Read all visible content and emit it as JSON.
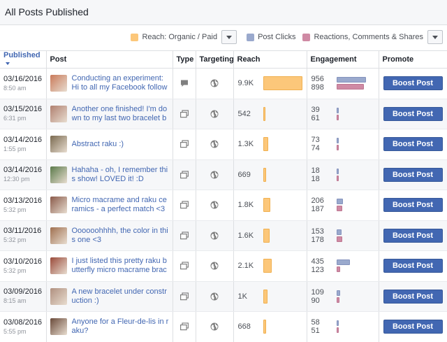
{
  "page_title": "All Posts Published",
  "legend": [
    {
      "label": "Reach: Organic / Paid",
      "color": "#fcc77a"
    },
    {
      "label": "Post Clicks",
      "color": "#9aa9cd"
    },
    {
      "label": "Reactions, Comments & Shares",
      "color": "#cf8aa4"
    }
  ],
  "columns": {
    "published": "Published",
    "post": "Post",
    "type": "Type",
    "targeting": "Targeting",
    "reach": "Reach",
    "engagement": "Engagement",
    "promote": "Promote"
  },
  "max_reach": 9900,
  "max_engagement": 956,
  "posts": [
    {
      "date": "03/16/2016",
      "time": "8:50 am",
      "text": "Conducting an experiment: Hi to all my Facebook followers! Did y",
      "type_icon": "chat-bubble-icon",
      "reach_label": "9.9K",
      "reach": 9900,
      "clicks": 956,
      "reactions": 898,
      "boost_label": "Boost Post",
      "thumb_color": "#c97a5a"
    },
    {
      "date": "03/15/2016",
      "time": "6:31 pm",
      "text": "Another one finished! I'm down to my last two bracelet bars :(",
      "type_icon": "photo-stack-icon",
      "reach_label": "542",
      "reach": 542,
      "clicks": 39,
      "reactions": 61,
      "boost_label": "Boost Post",
      "thumb_color": "#b08070"
    },
    {
      "date": "03/14/2016",
      "time": "1:55 pm",
      "text": "Abstract raku :)",
      "type_icon": "photo-stack-icon",
      "reach_label": "1.3K",
      "reach": 1300,
      "clicks": 73,
      "reactions": 74,
      "boost_label": "Boost Post",
      "thumb_color": "#7a6a50"
    },
    {
      "date": "03/14/2016",
      "time": "12:30 pm",
      "text": "Hahaha - oh, I remember this show! LOVED it! :D",
      "type_icon": "photo-stack-icon",
      "reach_label": "669",
      "reach": 669,
      "clicks": 18,
      "reactions": 18,
      "boost_label": "Boost Post",
      "thumb_color": "#5a7a4a"
    },
    {
      "date": "03/13/2016",
      "time": "5:32 pm",
      "text": "Micro macrame and raku ceramics - a perfect match <3",
      "type_icon": "photo-stack-icon",
      "reach_label": "1.8K",
      "reach": 1800,
      "clicks": 206,
      "reactions": 187,
      "boost_label": "Boost Post",
      "thumb_color": "#8a5a4a"
    },
    {
      "date": "03/11/2016",
      "time": "5:32 pm",
      "text": "Oooooohhhh, the color in this one <3",
      "type_icon": "photo-stack-icon",
      "reach_label": "1.6K",
      "reach": 1600,
      "clicks": 153,
      "reactions": 178,
      "boost_label": "Boost Post",
      "thumb_color": "#a07050"
    },
    {
      "date": "03/10/2016",
      "time": "5:32 pm",
      "text": "I just listed this pretty raku butterfly micro macrame bracelet in my",
      "type_icon": "photo-stack-icon",
      "reach_label": "2.1K",
      "reach": 2100,
      "clicks": 435,
      "reactions": 123,
      "boost_label": "Boost Post",
      "thumb_color": "#9a4a3a"
    },
    {
      "date": "03/09/2016",
      "time": "8:15 am",
      "text": "A new bracelet under construction :)",
      "type_icon": "photo-stack-icon",
      "reach_label": "1K",
      "reach": 1000,
      "clicks": 109,
      "reactions": 90,
      "boost_label": "Boost Post",
      "thumb_color": "#b09080"
    },
    {
      "date": "03/08/2016",
      "time": "5:55 pm",
      "text": "Anyone for a Fleur-de-lis in raku?",
      "type_icon": "photo-stack-icon",
      "reach_label": "668",
      "reach": 668,
      "clicks": 58,
      "reactions": 51,
      "boost_label": "Boost Post",
      "thumb_color": "#6a4a3a"
    }
  ]
}
